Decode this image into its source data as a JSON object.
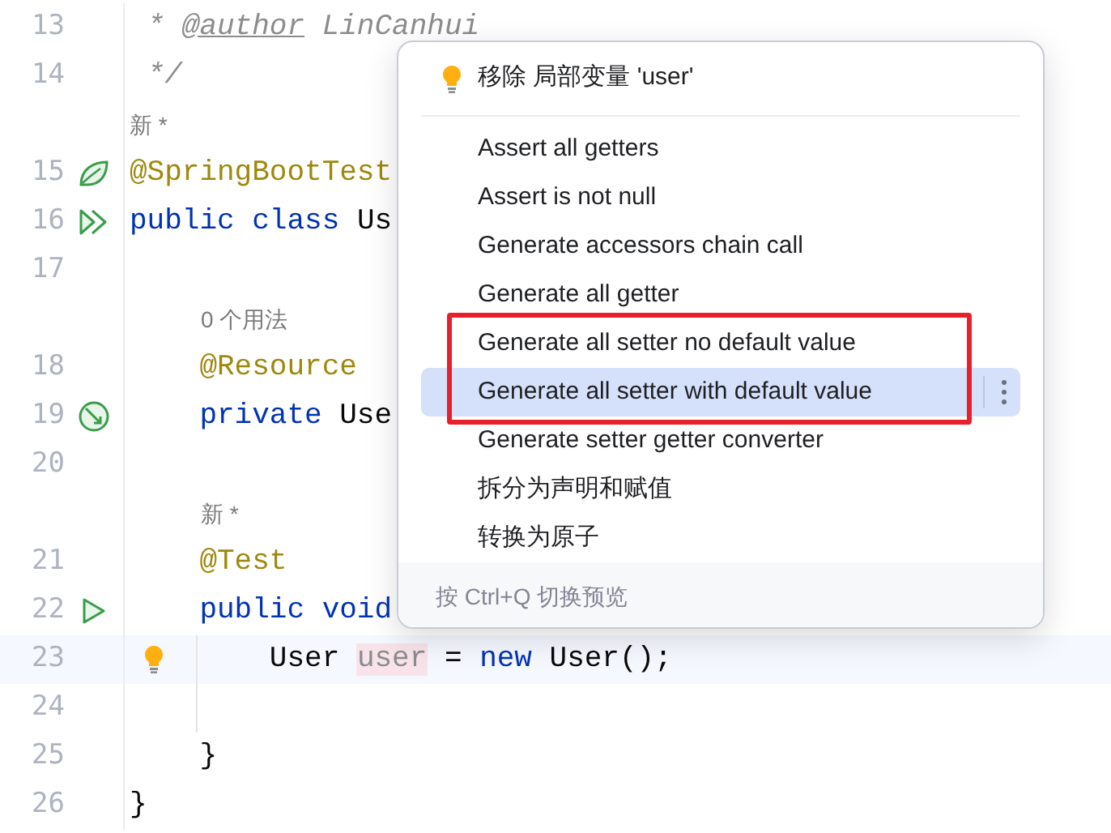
{
  "editor": {
    "rows": [
      {
        "kind": "code",
        "number": "13",
        "tokens": [
          {
            "kind": "comment",
            "text": " * "
          },
          {
            "kind": "doctag",
            "text": "@author"
          },
          {
            "kind": "comment",
            "text": " LinCanhui"
          }
        ]
      },
      {
        "kind": "code",
        "number": "14",
        "tokens": [
          {
            "kind": "comment",
            "text": " */"
          }
        ]
      },
      {
        "kind": "class-hint",
        "text": "新 *"
      },
      {
        "kind": "code",
        "number": "15",
        "gutter_icon": {
          "kind": "spring"
        },
        "tokens": [
          {
            "kind": "annotation",
            "text": "@SpringBootTest"
          }
        ]
      },
      {
        "kind": "code",
        "number": "16",
        "gutter_icon": {
          "kind": "run-class"
        },
        "tokens": [
          {
            "kind": "keyword",
            "text": "public class "
          },
          {
            "kind": "plain",
            "text": "Us"
          }
        ]
      },
      {
        "kind": "code",
        "number": "17",
        "tokens": []
      },
      {
        "kind": "member-hint",
        "text": "0 个用法"
      },
      {
        "kind": "code",
        "number": "18",
        "tokens": [
          {
            "kind": "annotation",
            "text": "    @Resource"
          }
        ]
      },
      {
        "kind": "code",
        "number": "19",
        "gutter_icon": {
          "kind": "bean"
        },
        "tokens": [
          {
            "kind": "keyword",
            "text": "    private "
          },
          {
            "kind": "plain",
            "text": "Use"
          }
        ]
      },
      {
        "kind": "code",
        "number": "20",
        "tokens": []
      },
      {
        "kind": "member-hint",
        "text": "新 *"
      },
      {
        "kind": "code",
        "number": "21",
        "tokens": [
          {
            "kind": "annotation",
            "text": "    @Test"
          }
        ]
      },
      {
        "kind": "code",
        "number": "22",
        "gutter_icon": {
          "kind": "run"
        },
        "tokens": [
          {
            "kind": "keyword",
            "text": "    public void"
          }
        ]
      },
      {
        "kind": "code",
        "number": "23",
        "current": true,
        "bulb": true,
        "tokens": [
          {
            "kind": "plain",
            "text": "        User "
          },
          {
            "kind": "unused",
            "text": "user"
          },
          {
            "kind": "plain",
            "text": " = "
          },
          {
            "kind": "keyword",
            "text": "new "
          },
          {
            "kind": "plain",
            "text": "User();"
          }
        ]
      },
      {
        "kind": "code",
        "number": "24",
        "tokens": []
      },
      {
        "kind": "code",
        "number": "25",
        "tokens": [
          {
            "kind": "plain",
            "text": "    }"
          }
        ]
      },
      {
        "kind": "code",
        "number": "26",
        "tokens": [
          {
            "kind": "plain",
            "text": "}"
          }
        ]
      }
    ]
  },
  "popup": {
    "header": "移除 局部变量 'user'",
    "items": [
      {
        "label": "Assert all getters",
        "selected": false,
        "boxed": false
      },
      {
        "label": "Assert is not null",
        "selected": false,
        "boxed": false
      },
      {
        "label": "Generate accessors chain call",
        "selected": false,
        "boxed": false
      },
      {
        "label": "Generate all getter",
        "selected": false,
        "boxed": false
      },
      {
        "label": "Generate all setter no default value",
        "selected": false,
        "boxed": true
      },
      {
        "label": "Generate all setter with default value",
        "selected": true,
        "boxed": true
      },
      {
        "label": "Generate setter getter converter",
        "selected": false,
        "boxed": false
      },
      {
        "label": "拆分为声明和赋值",
        "selected": false,
        "boxed": false
      },
      {
        "label": "转换为原子",
        "selected": false,
        "boxed": false
      }
    ],
    "footer": "按 Ctrl+Q 切换预览"
  }
}
